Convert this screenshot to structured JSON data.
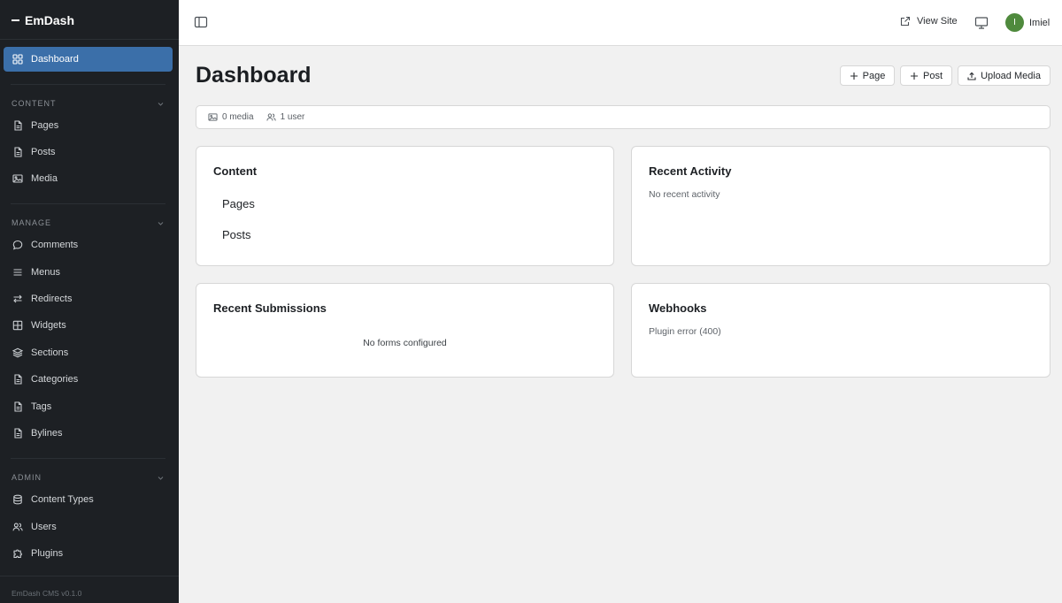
{
  "app": {
    "name": "EmDash",
    "version": "EmDash CMS v0.1.0"
  },
  "sidebar": {
    "dashboard": {
      "label": "Dashboard",
      "icon": "grid-icon"
    },
    "sections": [
      {
        "title": "CONTENT",
        "items": [
          {
            "label": "Pages",
            "icon": "file-icon"
          },
          {
            "label": "Posts",
            "icon": "file-icon"
          },
          {
            "label": "Media",
            "icon": "image-icon"
          }
        ]
      },
      {
        "title": "MANAGE",
        "items": [
          {
            "label": "Comments",
            "icon": "speech-bubble-icon"
          },
          {
            "label": "Menus",
            "icon": "menu-icon"
          },
          {
            "label": "Redirects",
            "icon": "arrows-swap-icon"
          },
          {
            "label": "Widgets",
            "icon": "grid-icon"
          },
          {
            "label": "Sections",
            "icon": "layers-icon"
          },
          {
            "label": "Categories",
            "icon": "file-icon"
          },
          {
            "label": "Tags",
            "icon": "file-icon"
          },
          {
            "label": "Bylines",
            "icon": "file-icon"
          }
        ]
      },
      {
        "title": "ADMIN",
        "items": [
          {
            "label": "Content Types",
            "icon": "database-icon"
          },
          {
            "label": "Users",
            "icon": "users-icon"
          },
          {
            "label": "Plugins",
            "icon": "puzzle-icon"
          }
        ]
      }
    ]
  },
  "topbar": {
    "view_site": "View Site",
    "user": {
      "initial": "I",
      "name": "Imiel"
    }
  },
  "main": {
    "title": "Dashboard",
    "actions": {
      "page": "Page",
      "post": "Post",
      "upload": "Upload Media"
    },
    "stats": {
      "media": "0 media",
      "users": "1 user"
    },
    "cards": {
      "content": {
        "title": "Content",
        "links": [
          "Pages",
          "Posts"
        ]
      },
      "recent_activity": {
        "title": "Recent Activity",
        "note": "No recent activity"
      },
      "recent_submissions": {
        "title": "Recent Submissions",
        "note": "No forms configured"
      },
      "webhooks": {
        "title": "Webhooks",
        "note": "Plugin error (400)"
      }
    }
  },
  "colors": {
    "sidebar_bg": "#1d2024",
    "active_item": "#3b6fa9",
    "avatar": "#4f8a3d",
    "page_bg": "#f1f1f1"
  }
}
